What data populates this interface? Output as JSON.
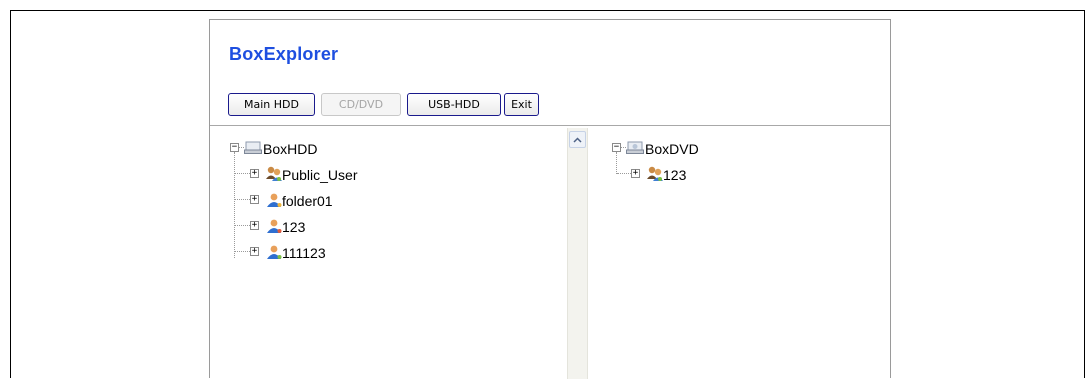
{
  "app": {
    "title": "BoxExplorer"
  },
  "toolbar": {
    "buttons": [
      {
        "label": "Main HDD",
        "enabled": true
      },
      {
        "label": "CD/DVD",
        "enabled": false
      },
      {
        "label": "USB-HDD",
        "enabled": true
      },
      {
        "label": "Exit",
        "enabled": true
      }
    ]
  },
  "left_tree": {
    "root": {
      "label": "BoxHDD",
      "icon": "hard-drive-icon"
    },
    "children": [
      {
        "label": "Public_User",
        "icon": "group-users-icon"
      },
      {
        "label": "folder01",
        "icon": "user-folder-icon"
      },
      {
        "label": "123",
        "icon": "user-folder-icon"
      },
      {
        "label": "111123",
        "icon": "user-folder-icon"
      }
    ]
  },
  "right_tree": {
    "root": {
      "label": "BoxDVD",
      "icon": "dvd-drive-icon"
    },
    "children": [
      {
        "label": "123",
        "icon": "group-users-icon"
      }
    ]
  },
  "colors": {
    "title": "#1e4fe0",
    "button_border": "#1a1a8c",
    "disabled_text": "#a6a6a6"
  }
}
